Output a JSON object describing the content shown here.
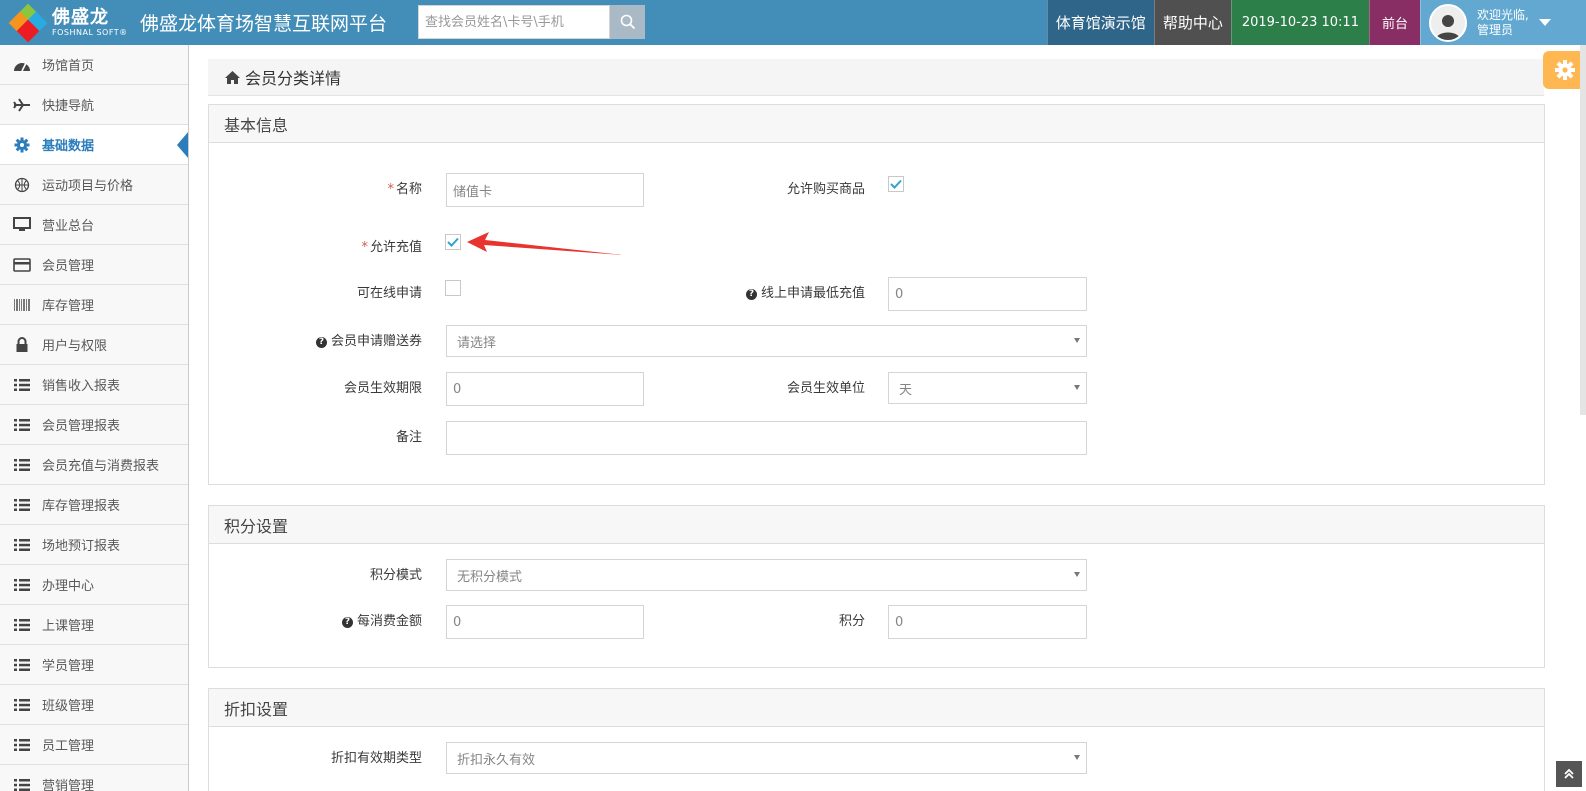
{
  "header": {
    "logo_cn": "佛盛龙",
    "logo_en": "FOSHNAL SOFT®",
    "app_title": "佛盛龙体育场智慧互联网平台",
    "search_placeholder": "查找会员姓名\\卡号\\手机",
    "venue": "体育馆演示馆",
    "help": "帮助中心",
    "datetime": "2019-10-23 10:11",
    "front_desk": "前台",
    "welcome": "欢迎光临,",
    "user_role": "管理员"
  },
  "sidebar": {
    "items": [
      {
        "label": "场馆首页",
        "icon": "dashboard-icon"
      },
      {
        "label": "快捷导航",
        "icon": "plane-icon"
      },
      {
        "label": "基础数据",
        "icon": "gear-icon",
        "active": true
      },
      {
        "label": "运动项目与价格",
        "icon": "basketball-icon"
      },
      {
        "label": "营业总台",
        "icon": "monitor-icon"
      },
      {
        "label": "会员管理",
        "icon": "card-icon"
      },
      {
        "label": "库存管理",
        "icon": "barcode-icon"
      },
      {
        "label": "用户与权限",
        "icon": "lock-icon"
      },
      {
        "label": "销售收入报表",
        "icon": "list-icon"
      },
      {
        "label": "会员管理报表",
        "icon": "list-icon"
      },
      {
        "label": "会员充值与消费报表",
        "icon": "list-icon"
      },
      {
        "label": "库存管理报表",
        "icon": "list-icon"
      },
      {
        "label": "场地预订报表",
        "icon": "list-icon"
      },
      {
        "label": "办理中心",
        "icon": "list-icon"
      },
      {
        "label": "上课管理",
        "icon": "list-icon"
      },
      {
        "label": "学员管理",
        "icon": "list-icon"
      },
      {
        "label": "班级管理",
        "icon": "list-icon"
      },
      {
        "label": "员工管理",
        "icon": "list-icon"
      },
      {
        "label": "营销管理",
        "icon": "list-icon"
      }
    ]
  },
  "page": {
    "title": "会员分类详情"
  },
  "basic": {
    "heading": "基本信息",
    "name_label": "名称",
    "name_value": "储值卡",
    "allow_buy_label": "允许购买商品",
    "allow_buy_checked": true,
    "allow_recharge_label": "允许充值",
    "allow_recharge_checked": true,
    "online_apply_label": "可在线申请",
    "online_apply_checked": false,
    "online_min_label": "线上申请最低充值",
    "online_min_value": "0",
    "coupon_label": "会员申请赠送券",
    "coupon_value": "请选择",
    "valid_period_label": "会员生效期限",
    "valid_period_value": "0",
    "valid_unit_label": "会员生效单位",
    "valid_unit_value": "天",
    "remark_label": "备注",
    "remark_value": ""
  },
  "points": {
    "heading": "积分设置",
    "mode_label": "积分模式",
    "mode_value": "无积分模式",
    "per_amount_label": "每消费金额",
    "per_amount_value": "0",
    "points_label": "积分",
    "points_value": "0"
  },
  "discount": {
    "heading": "折扣设置",
    "valid_type_label": "折扣有效期类型",
    "valid_type_value": "折扣永久有效"
  },
  "colors": {
    "header_bg": "#438eb9",
    "accent": "#2b7dbc",
    "annotation_arrow": "#e8332e"
  }
}
